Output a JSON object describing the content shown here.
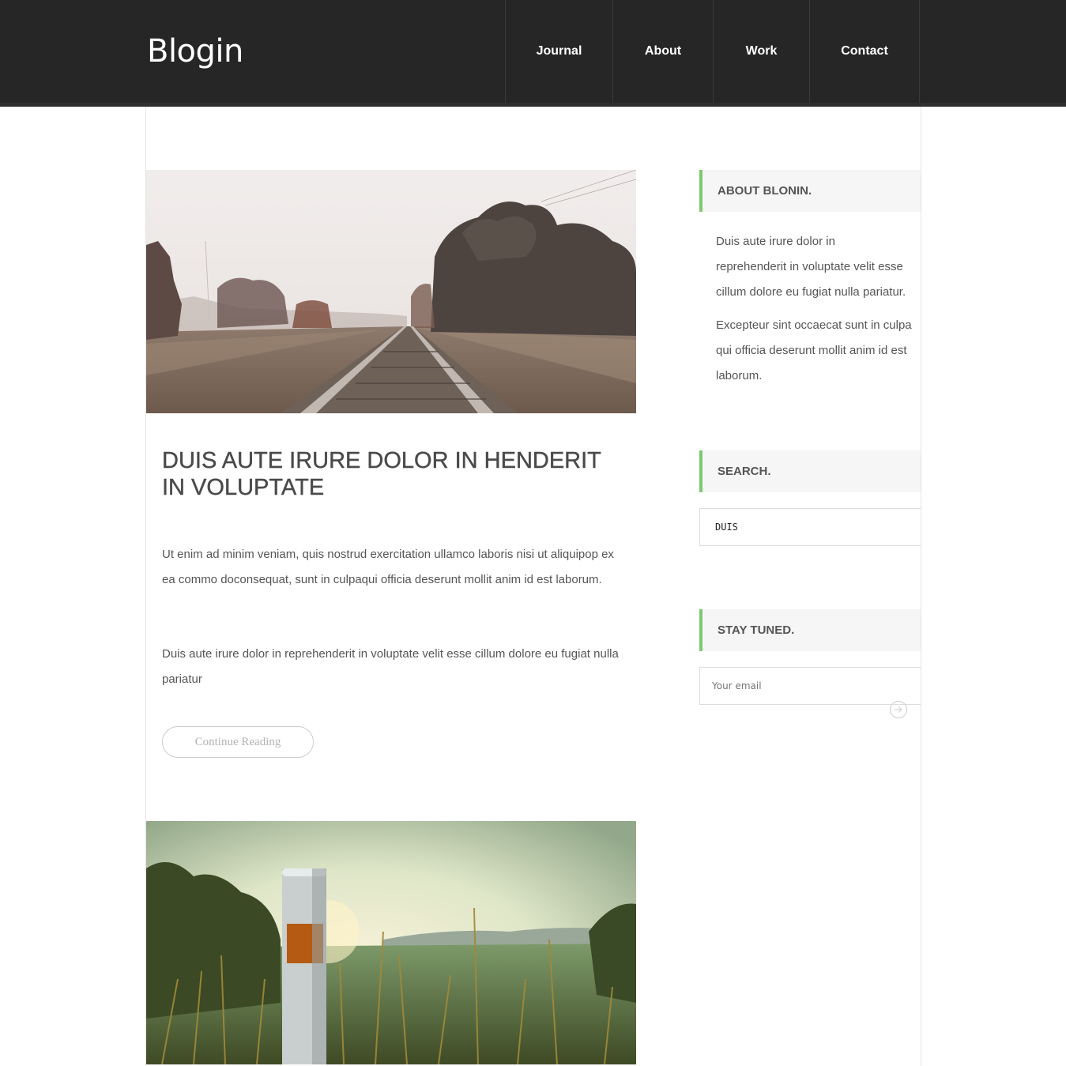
{
  "header": {
    "logo": "Blogin",
    "nav": [
      {
        "label": "Journal"
      },
      {
        "label": "About"
      },
      {
        "label": "Work"
      },
      {
        "label": "Contact"
      }
    ]
  },
  "post": {
    "title": "DUIS AUTE IRURE DOLOR IN HENDERIT IN VOLUPTATE",
    "paragraphs": [
      "Ut enim ad minim veniam, quis nostrud exercitation ullamco laboris nisi ut aliquipop ex ea commo doconsequat, sunt in culpaqui officia deserunt mollit anim id est laborum.",
      "Duis aute irure dolor in reprehenderit in voluptate velit esse cillum dolore eu fugiat nulla pariatur"
    ],
    "continue_label": "Continue Reading"
  },
  "sidebar": {
    "about": {
      "heading": "ABOUT BLONIN.",
      "p1_lines": [
        "Duis aute irure dolor in",
        "reprehenderit in voluptate velit esse",
        "cillum dolore eu fugiat nulla pariatur."
      ],
      "p2_lines": [
        "Excepteur sint occaecat sunt in culpa",
        "qui officia deserunt mollit anim id est",
        "laborum."
      ]
    },
    "search": {
      "heading": "SEARCH.",
      "value": "DUIS"
    },
    "stay_tuned": {
      "heading": "STAY TUNED.",
      "email_placeholder": "Your email"
    }
  },
  "icons": {
    "submit": "arrow-circle-right-icon"
  },
  "colors": {
    "header_bg": "#262626",
    "accent": "#7ec86f",
    "widget_bg": "#f6f6f6"
  }
}
